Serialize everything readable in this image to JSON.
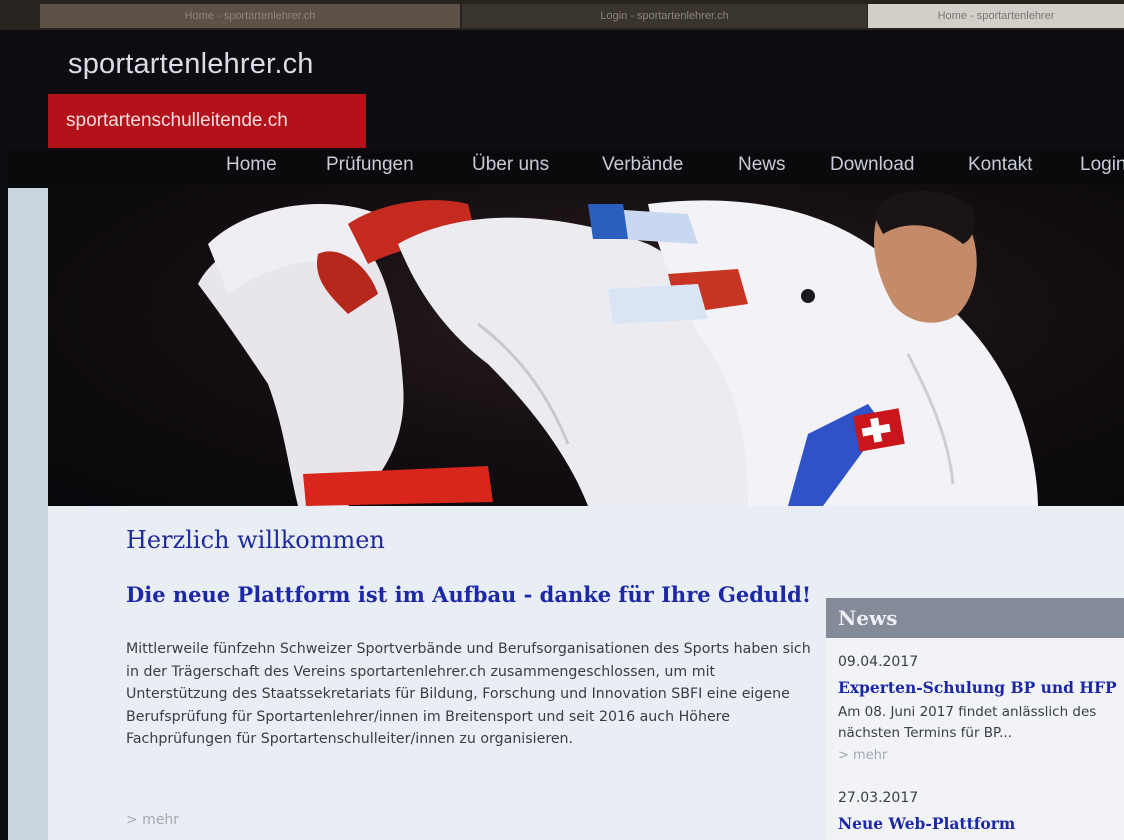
{
  "browser": {
    "tabs": [
      {
        "label": "Home - sportartenlehrer.ch"
      },
      {
        "label": "Login - sportartenlehrer.ch"
      },
      {
        "label": "Home - sportartenlehrer"
      }
    ]
  },
  "header": {
    "site_title": "sportartenlehrer.ch",
    "sub_brand": "sportartenschulleitende.ch"
  },
  "nav": {
    "items": [
      {
        "label": "Home"
      },
      {
        "label": "Prüfungen"
      },
      {
        "label": "Über uns"
      },
      {
        "label": "Verbände"
      },
      {
        "label": "News"
      },
      {
        "label": "Download"
      },
      {
        "label": "Kontakt"
      },
      {
        "label": "Login"
      }
    ]
  },
  "main": {
    "welcome": "Herzlich willkommen",
    "headline": "Die neue Plattform ist im Aufbau - danke für Ihre Geduld!",
    "body": "Mittlerweile fünfzehn Schweizer Sportverbände und Berufsorganisationen des Sports haben sich in der Trägerschaft des Vereins sportartenlehrer.ch zusammengeschlossen, um mit Unterstützung des Staatssekretariats für Bildung, Forschung und Innovation SBFI eine eigene Berufsprüfung für Sportartenlehrer/innen im Breitensport und seit 2016 auch Höhere Fachprüfungen für Sportartenschulleiter/innen zu organisieren.",
    "more": "> mehr"
  },
  "news": {
    "heading": "News",
    "items": [
      {
        "date": "09.04.2017",
        "title": "Experten-Schulung BP und HFP",
        "text": "Am 08. Juni 2017 findet anlässlich des nächsten Termins für BP...",
        "more": "> mehr"
      },
      {
        "date": "27.03.2017",
        "title": "Neue Web-Plattform"
      }
    ]
  },
  "colors": {
    "brand_red": "#b3121a",
    "heading_blue": "#1c28a6",
    "news_header": "#838a98",
    "content_bg": "#e9eef5"
  }
}
